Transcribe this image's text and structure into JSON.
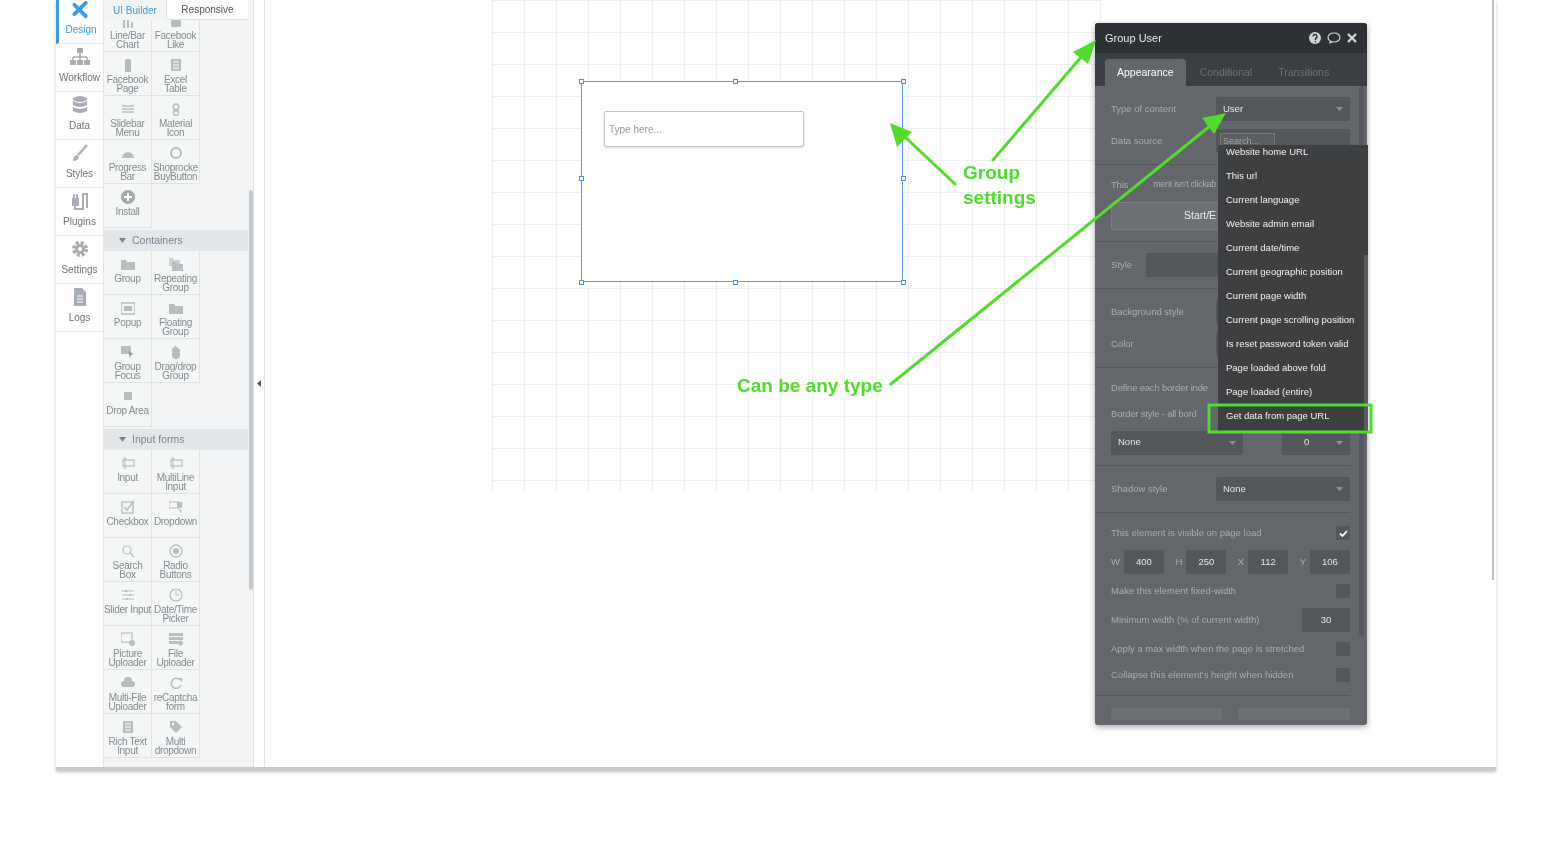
{
  "nav": [
    {
      "label": "Design",
      "selected": true
    },
    {
      "label": "Workflow",
      "selected": false
    },
    {
      "label": "Data",
      "selected": false
    },
    {
      "label": "Styles",
      "selected": false
    },
    {
      "label": "Plugins",
      "selected": false
    },
    {
      "label": "Settings",
      "selected": false
    },
    {
      "label": "Logs",
      "selected": false
    }
  ],
  "palette": {
    "tabs": [
      {
        "label": "UI Builder",
        "selected": true
      },
      {
        "label": "Responsive",
        "selected": false
      }
    ],
    "sections": [
      {
        "items": [
          "Line/Bar Chart",
          "Facebook Like",
          "Facebook Page",
          "Excel Table",
          "Slidebar Menu",
          "Material Icon",
          "Progress Bar",
          "Shoprocke BuyButton",
          "Install"
        ]
      },
      {
        "title": "Containers",
        "expanded": true,
        "items": [
          "Group",
          "Repeating Group",
          "Popup",
          "Floating Group",
          "Group Focus",
          "Drag/drop Group",
          "Drop Area"
        ]
      },
      {
        "title": "Input forms",
        "expanded": true,
        "items": [
          "Input",
          "MultiLine Input",
          "Checkbox",
          "Dropdown",
          "Search Box",
          "Radio Buttons",
          "Slider Input",
          "Date/Time Picker",
          "Picture Uploader",
          "File Uploader",
          "Multi-File Uploader",
          "reCaptcha form",
          "Rich Text Input",
          "Multi dropdown"
        ]
      }
    ]
  },
  "canvas": {
    "input": {
      "placeholder": "Type here..."
    }
  },
  "annotations": [
    "Group settings",
    "Can be any type"
  ],
  "property_editor": {
    "title": "Group User",
    "tabs": [
      {
        "label": "Appearance",
        "selected": true
      },
      {
        "label": "Conditional",
        "selected": false
      },
      {
        "label": "Transitions",
        "selected": false
      }
    ],
    "sections": [
      [
        {
          "kind": "select",
          "label": "Type of content",
          "value": "User"
        },
        {
          "kind": "search",
          "label": "Data source",
          "placeholder": "Search..."
        }
      ],
      [
        {
          "kind": "note",
          "text": "This",
          "text_2": "ment isn't clickab"
        },
        {
          "kind": "button",
          "label": "Start/E"
        }
      ],
      [
        {
          "kind": "picker",
          "label": "Style"
        }
      ],
      [
        {
          "kind": "field",
          "label": "Background style"
        },
        {
          "kind": "field",
          "label": "Color"
        }
      ],
      [
        {
          "kind": "note",
          "text": "Define each border inde"
        },
        {
          "kind": "note",
          "text": "Border style - all bord"
        },
        {
          "kind": "pair",
          "value": "None",
          "value_2": "0"
        }
      ],
      [
        {
          "kind": "select",
          "label": "Shadow style",
          "value": "None"
        }
      ],
      [
        {
          "kind": "checkbox",
          "label": "This element is visible on page load",
          "checked": true
        },
        {
          "kind": "dims",
          "items": [
            {
              "label": "W",
              "value": "400"
            },
            {
              "label": "H",
              "value": "250"
            },
            {
              "label": "X",
              "value": "112"
            },
            {
              "label": "Y",
              "value": "106"
            }
          ]
        },
        {
          "kind": "checkbox",
          "label": "Make this element fixed-width",
          "checked": false
        },
        {
          "kind": "number",
          "label": "Minimum width (% of current width)",
          "value": "30"
        },
        {
          "kind": "checkbox",
          "label": "Apply a max width when the page is stretched",
          "checked": false
        },
        {
          "kind": "checkbox",
          "label": "Collapse this element's height when hidden",
          "checked": false
        }
      ]
    ],
    "dropdown": {
      "items": [
        "Website home URL",
        "This url",
        "Current language",
        "Website admin email",
        "Current date/time",
        "Current geographic position",
        "Current page width",
        "Current page scrolling position",
        "Is reset password token valid",
        "Page loaded above fold",
        "Page loaded (entire)",
        "Get data from page URL"
      ]
    }
  }
}
